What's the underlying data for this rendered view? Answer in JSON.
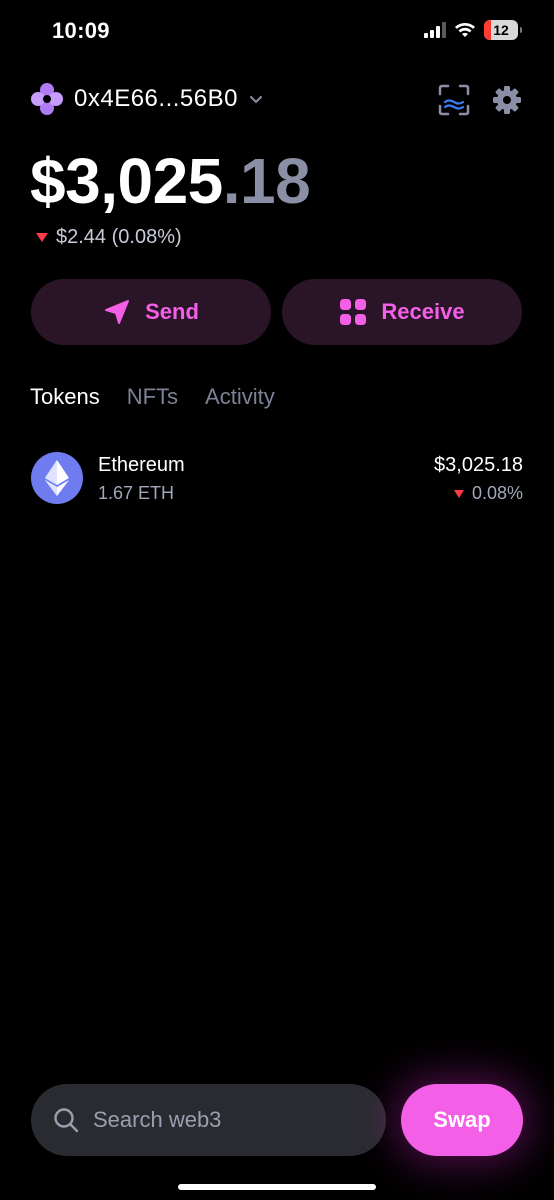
{
  "status_bar": {
    "time": "10:09",
    "battery": "12"
  },
  "header": {
    "address": "0x4E66...56B0"
  },
  "balance": {
    "dollars": "$3,025",
    "cents": ".18",
    "change": "$2.44 (0.08%)"
  },
  "actions": {
    "send_label": "Send",
    "receive_label": "Receive"
  },
  "tabs": [
    {
      "label": "Tokens",
      "active": true
    },
    {
      "label": "NFTs",
      "active": false
    },
    {
      "label": "Activity",
      "active": false
    }
  ],
  "tokens": [
    {
      "name": "Ethereum",
      "amount": "1.67 ETH",
      "value": "$3,025.18",
      "change": "0.08%",
      "icon": "ethereum-icon"
    }
  ],
  "bottom": {
    "search_placeholder": "Search web3",
    "swap_label": "Swap"
  },
  "colors": {
    "accent": "#f35fe6",
    "negative": "#ff3b47",
    "eth": "#6f7cf0"
  }
}
